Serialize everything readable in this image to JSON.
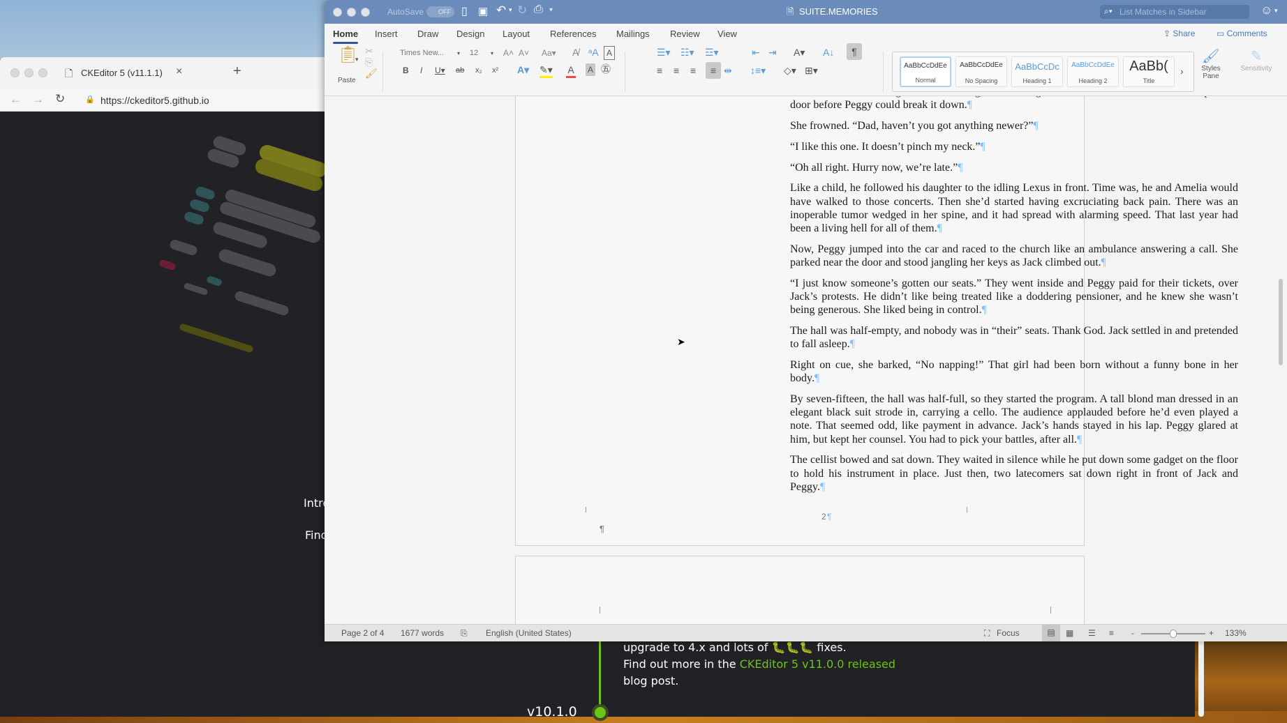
{
  "browser": {
    "tab_title": "CKEditor 5 (v11.1.1)",
    "url": "https://ckeditor5.github.io",
    "partial_texts": [
      "Intro",
      "Find"
    ],
    "panel": {
      "line1": "upgrade to 4.x and lots of 🐛🐛🐛 fixes.",
      "line2_prefix": "Find out more in the",
      "line2_link": "CKEditor 5 v11.0.0 released",
      "line3": "blog post.",
      "version": "v10.1.0"
    }
  },
  "word": {
    "autosave_label": "AutoSave",
    "autosave_state": "OFF",
    "doc_title": "SUITE.MEMORIES",
    "search_placeholder": "List Matches in Sidebar",
    "tabs": [
      "Home",
      "Insert",
      "Draw",
      "Design",
      "Layout",
      "References",
      "Mailings",
      "Review",
      "View"
    ],
    "active_tab": "Home",
    "share_label": "Share",
    "comments_label": "Comments",
    "ribbon": {
      "paste_label": "Paste",
      "font_name": "Times New...",
      "font_size": "12",
      "styles": [
        {
          "preview": "AaBbCcDdEe",
          "name": "Normal"
        },
        {
          "preview": "AaBbCcDdEe",
          "name": "No Spacing"
        },
        {
          "preview": "AaBbCcDc",
          "name": "Heading 1"
        },
        {
          "preview": "AaBbCcDdEe",
          "name": "Heading 2"
        },
        {
          "preview": "AaBb(",
          "name": "Title"
        }
      ],
      "styles_pane_label": "Styles Pane",
      "sensitivity_label": "Sensitivity"
    },
    "document": {
      "paragraphs": [
        "The doorbell shrilled again. “I’m coming, I’m coming!” He hobbled down the stairs to open the door before Peggy could break it down.",
        "She frowned. “Dad, haven’t you got anything newer?”",
        "“I like this one. It doesn’t pinch my neck.”",
        "“Oh all right. Hurry now, we’re late.”",
        "Like a child, he followed his daughter to the idling Lexus in front. Time was, he and Amelia would have walked to those concerts. Then she’d started having excruciating back pain. There was an inoperable tumor wedged in her spine, and it had spread with alarming speed. That last year had been a living hell for all of them.",
        "Now, Peggy jumped into the car and raced to the church like an ambulance answering a call. She parked near the door and stood jangling her keys as Jack climbed out.",
        "“I just know someone’s gotten our seats.” They went inside and Peggy paid for their tickets, over Jack’s protests. He didn’t like being treated like a doddering pensioner, and he knew she wasn’t being generous. She liked being in control.",
        "The hall was half-empty, and nobody was in “their” seats. Thank God. Jack settled in and pretended to fall asleep.",
        "Right on cue, she barked, “No napping!” That girl had been born without a funny bone in her body.",
        "By seven-fifteen, the hall was half-full, so they started the program. A tall blond man dressed in an elegant black suit strode in, carrying a cello.  The audience applauded before he’d even played a note. That seemed odd, like payment in advance. Jack’s hands stayed in his lap. Peggy glared at him, but kept her counsel. You had to pick your battles, after all.",
        "The cellist bowed and sat down. They waited in silence while he put down some gadget on the floor to hold his instrument in place. Just then, two latecomers sat down right in front of Jack and Peggy."
      ],
      "page_number": "2",
      "empty_paragraph_mark": "¶"
    },
    "status": {
      "page": "Page 2 of 4",
      "words": "1677 words",
      "language": "English (United States)",
      "focus_label": "Focus",
      "zoom": "133%",
      "zoom_percent": 133
    }
  },
  "colors": {
    "title_bar": "#6b8cba",
    "accent": "#2b579a",
    "ck_green": "#6cc417"
  }
}
